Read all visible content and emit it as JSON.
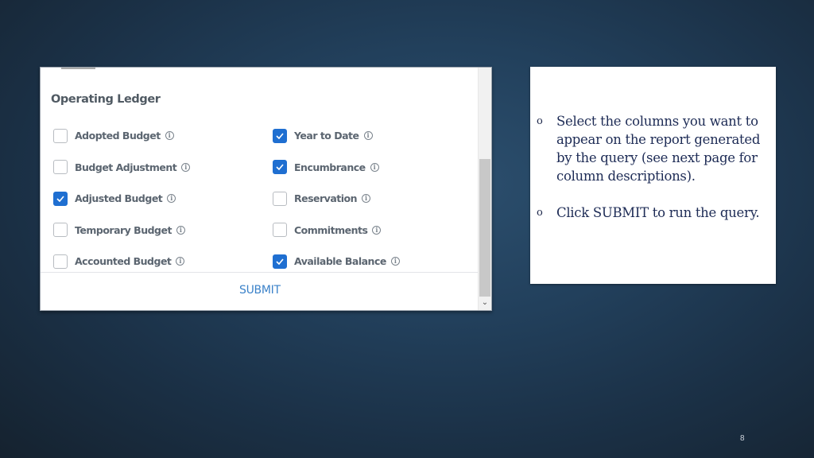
{
  "panel": {
    "section_title": "Operating Ledger",
    "left_options": [
      {
        "label": "Adopted Budget",
        "checked": false
      },
      {
        "label": "Budget Adjustment",
        "checked": false
      },
      {
        "label": "Adjusted Budget",
        "checked": true
      },
      {
        "label": "Temporary Budget",
        "checked": false
      },
      {
        "label": "Accounted Budget",
        "checked": false
      }
    ],
    "right_options": [
      {
        "label": "Year to Date",
        "checked": true
      },
      {
        "label": "Encumbrance",
        "checked": true
      },
      {
        "label": "Reservation",
        "checked": false
      },
      {
        "label": "Commitments",
        "checked": false
      },
      {
        "label": "Available Balance",
        "checked": true
      }
    ],
    "info_icon_glyph": "i",
    "submit_label": "SUBMIT",
    "scroll_down_glyph": "⌄"
  },
  "note": {
    "bullet_glyph": "o",
    "items": [
      "Select the columns you want to appear on the report generated by the query (see next page for column descriptions).",
      "Click SUBMIT to run the query."
    ]
  },
  "page_number": "8",
  "colors": {
    "accent": "#1f6fd1",
    "submit_text": "#3b82c9",
    "note_text": "#1d2b55"
  }
}
